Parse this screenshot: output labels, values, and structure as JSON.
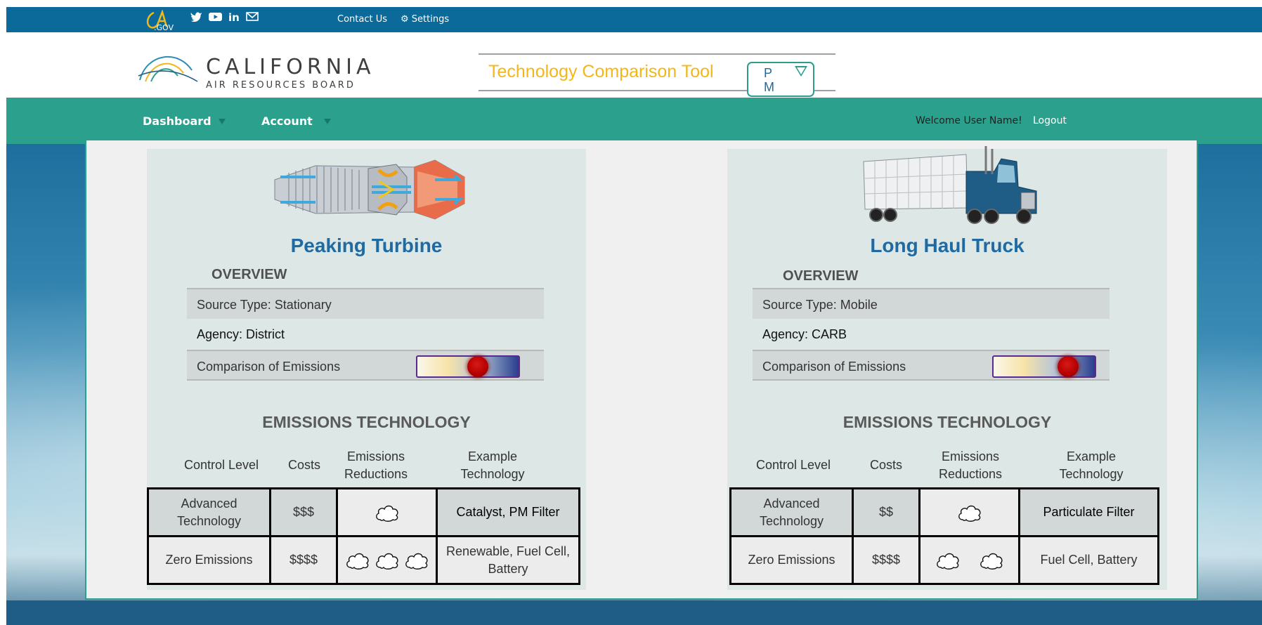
{
  "topbar": {
    "ca_logo_text": "CA.GOV",
    "social_icons": [
      "twitter-icon",
      "youtube-icon",
      "linkedin-icon",
      "mail-icon"
    ],
    "contact_label": "Contact Us",
    "settings_label": "Settings"
  },
  "header": {
    "org_title": "CALIFORNIA",
    "org_subtitle": "AIR RESOURCES BOARD",
    "tool_title": "Technology Comparison Tool",
    "pollutant_selected": "PM"
  },
  "nav": {
    "dashboard_label": "Dashboard",
    "account_label": "Account",
    "welcome_text": "Welcome User Name!",
    "logout_label": "Logout"
  },
  "colors": {
    "topbar": "#0b6a99",
    "nav": "#2ba08d",
    "title_blue": "#1f6aa1",
    "accent_yellow": "#f2b71a"
  },
  "panels": [
    {
      "title": "Peaking Turbine",
      "image_icon": "turbine-icon",
      "overview_label": "OVERVIEW",
      "source_type": "Source Type: Stationary",
      "agency": "Agency: District",
      "comparison_label": "Comparison of Emissions",
      "comparison_level": 0.62,
      "section_title": "EMISSIONS TECHNOLOGY",
      "columns": [
        "Control Level",
        "Costs",
        "Emissions Reductions",
        "Example Technology"
      ],
      "rows": [
        {
          "level": "Advanced Technology",
          "cost": "$$$",
          "reductions": 1,
          "example": "Catalyst, PM Filter"
        },
        {
          "level": "Zero Emissions",
          "cost": "$$$$",
          "reductions": 3,
          "example": "Renewable, Fuel Cell, Battery"
        }
      ]
    },
    {
      "title": "Long Haul Truck",
      "image_icon": "truck-icon",
      "overview_label": "OVERVIEW",
      "source_type": "Source Type: Mobile",
      "agency": "Agency: CARB",
      "comparison_label": "Comparison of Emissions",
      "comparison_level": 0.8,
      "section_title": "EMISSIONS TECHNOLOGY",
      "columns": [
        "Control Level",
        "Costs",
        "Emissions Reductions",
        "Example Technology"
      ],
      "rows": [
        {
          "level": "Advanced Technology",
          "cost": "$$",
          "reductions": 1,
          "example": "Particulate Filter"
        },
        {
          "level": "Zero Emissions",
          "cost": "$$$$",
          "reductions": 2,
          "example": "Fuel Cell, Battery"
        }
      ]
    }
  ]
}
